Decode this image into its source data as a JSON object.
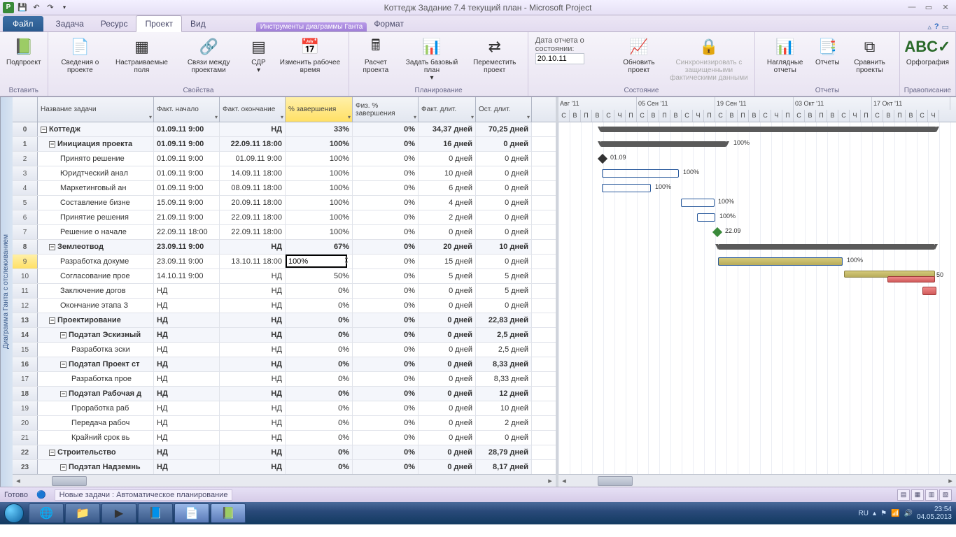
{
  "app_title": "Коттедж Задание 7.4 текущий план - Microsoft Project",
  "context_tab_header": "Инструменты диаграммы Ганта",
  "tabs": {
    "file": "Файл",
    "task": "Задача",
    "resource": "Ресурс",
    "project": "Проект",
    "view": "Вид",
    "format": "Формат"
  },
  "ribbon": {
    "insert_group": "Вставить",
    "subproject": "Подпроект",
    "props_group": "Свойства",
    "info": "Сведения о проекте",
    "custom": "Настраиваемые поля",
    "links": "Связи между проектами",
    "wbs": "СДР",
    "chtime": "Изменить рабочее время",
    "planning_group": "Планирование",
    "calc": "Расчет проекта",
    "baseline": "Задать базовый план",
    "move": "Переместить проект",
    "status_date_label": "Дата отчета о состоянии:",
    "status_date": "20.10.11",
    "state_group": "Состояние",
    "update": "Обновить проект",
    "sync": "Синхронизировать с защищенными фактическими данными",
    "reports_group": "Отчеты",
    "visrep": "Наглядные отчеты",
    "reports": "Отчеты",
    "compare": "Сравнить проекты",
    "spelling_group": "Правописание",
    "spelling": "Орфография"
  },
  "vertical_tab": "Диаграмма Ганта с отслеживанием",
  "columns": {
    "name": "Название задачи",
    "start": "Факт. начало",
    "end": "Факт. окончание",
    "pct": "% завершения",
    "phys": "Физ. % завершения",
    "dur": "Факт. длит.",
    "rem": "Ост. длит."
  },
  "timeline_months": [
    "Авг '11",
    "05 Сен '11",
    "19 Сен '11",
    "03 Окт '11",
    "17 Окт '11"
  ],
  "timeline_days": [
    "С",
    "В",
    "П",
    "В",
    "С",
    "Ч",
    "П",
    "С",
    "В",
    "П",
    "В",
    "С",
    "Ч",
    "П",
    "С",
    "В",
    "П",
    "В",
    "С",
    "Ч",
    "П",
    "С",
    "В",
    "П",
    "В",
    "С",
    "Ч",
    "П",
    "С",
    "В",
    "П",
    "В",
    "С",
    "Ч"
  ],
  "editor_value": "100%",
  "rows": [
    {
      "n": "0",
      "sum": true,
      "ind": 0,
      "name": "Коттедж",
      "start": "01.09.11 9:00",
      "end": "НД",
      "pct": "33%",
      "phys": "0%",
      "dur": "34,37 дней",
      "rem": "70,25 дней"
    },
    {
      "n": "1",
      "sum": true,
      "ind": 1,
      "name": "Инициация проекта",
      "start": "01.09.11 9:00",
      "end": "22.09.11 18:00",
      "pct": "100%",
      "phys": "0%",
      "dur": "16 дней",
      "rem": "0 дней"
    },
    {
      "n": "2",
      "ind": 2,
      "name": "Принято решение",
      "start": "01.09.11 9:00",
      "end": "01.09.11 9:00",
      "pct": "100%",
      "phys": "0%",
      "dur": "0 дней",
      "rem": "0 дней"
    },
    {
      "n": "3",
      "ind": 2,
      "name": "Юридтческий анал",
      "start": "01.09.11 9:00",
      "end": "14.09.11 18:00",
      "pct": "100%",
      "phys": "0%",
      "dur": "10 дней",
      "rem": "0 дней"
    },
    {
      "n": "4",
      "ind": 2,
      "name": "Маркетинговый ан",
      "start": "01.09.11 9:00",
      "end": "08.09.11 18:00",
      "pct": "100%",
      "phys": "0%",
      "dur": "6 дней",
      "rem": "0 дней"
    },
    {
      "n": "5",
      "ind": 2,
      "name": "Составление бизне",
      "start": "15.09.11 9:00",
      "end": "20.09.11 18:00",
      "pct": "100%",
      "phys": "0%",
      "dur": "4 дней",
      "rem": "0 дней"
    },
    {
      "n": "6",
      "ind": 2,
      "name": "Принятие решения",
      "start": "21.09.11 9:00",
      "end": "22.09.11 18:00",
      "pct": "100%",
      "phys": "0%",
      "dur": "2 дней",
      "rem": "0 дней"
    },
    {
      "n": "7",
      "ind": 2,
      "name": "Решение о начале",
      "start": "22.09.11 18:00",
      "end": "22.09.11 18:00",
      "pct": "100%",
      "phys": "0%",
      "dur": "0 дней",
      "rem": "0 дней"
    },
    {
      "n": "8",
      "sum": true,
      "ind": 1,
      "name": "Землеотвод",
      "start": "23.09.11 9:00",
      "end": "НД",
      "pct": "67%",
      "phys": "0%",
      "dur": "20 дней",
      "rem": "10 дней"
    },
    {
      "n": "9",
      "ind": 2,
      "name": "Разработка докуме",
      "start": "23.09.11 9:00",
      "end": "13.10.11 18:00",
      "pct": "",
      "phys": "0%",
      "dur": "15 дней",
      "rem": "0 дней",
      "editor": true
    },
    {
      "n": "10",
      "ind": 2,
      "name": "Согласование прое",
      "start": "14.10.11 9:00",
      "end": "НД",
      "pct": "50%",
      "phys": "0%",
      "dur": "5 дней",
      "rem": "5 дней"
    },
    {
      "n": "11",
      "ind": 2,
      "name": "Заключение догов",
      "start": "НД",
      "end": "НД",
      "pct": "0%",
      "phys": "0%",
      "dur": "0 дней",
      "rem": "5 дней"
    },
    {
      "n": "12",
      "ind": 2,
      "name": "Окончание этапа З",
      "start": "НД",
      "end": "НД",
      "pct": "0%",
      "phys": "0%",
      "dur": "0 дней",
      "rem": "0 дней"
    },
    {
      "n": "13",
      "sum": true,
      "ind": 1,
      "name": "Проектирование",
      "start": "НД",
      "end": "НД",
      "pct": "0%",
      "phys": "0%",
      "dur": "0 дней",
      "rem": "22,83 дней"
    },
    {
      "n": "14",
      "sum": true,
      "ind": 2,
      "name": "Подэтап Эскизный",
      "start": "НД",
      "end": "НД",
      "pct": "0%",
      "phys": "0%",
      "dur": "0 дней",
      "rem": "2,5 дней"
    },
    {
      "n": "15",
      "ind": 3,
      "name": "Разработка эски",
      "start": "НД",
      "end": "НД",
      "pct": "0%",
      "phys": "0%",
      "dur": "0 дней",
      "rem": "2,5 дней"
    },
    {
      "n": "16",
      "sum": true,
      "ind": 2,
      "name": "Подэтап Проект ст",
      "start": "НД",
      "end": "НД",
      "pct": "0%",
      "phys": "0%",
      "dur": "0 дней",
      "rem": "8,33 дней"
    },
    {
      "n": "17",
      "ind": 3,
      "name": "Разработка прое",
      "start": "НД",
      "end": "НД",
      "pct": "0%",
      "phys": "0%",
      "dur": "0 дней",
      "rem": "8,33 дней"
    },
    {
      "n": "18",
      "sum": true,
      "ind": 2,
      "name": "Подэтап Рабочая д",
      "start": "НД",
      "end": "НД",
      "pct": "0%",
      "phys": "0%",
      "dur": "0 дней",
      "rem": "12 дней"
    },
    {
      "n": "19",
      "ind": 3,
      "name": "Проработка раб",
      "start": "НД",
      "end": "НД",
      "pct": "0%",
      "phys": "0%",
      "dur": "0 дней",
      "rem": "10 дней"
    },
    {
      "n": "20",
      "ind": 3,
      "name": "Передача рабоч",
      "start": "НД",
      "end": "НД",
      "pct": "0%",
      "phys": "0%",
      "dur": "0 дней",
      "rem": "2 дней"
    },
    {
      "n": "21",
      "ind": 3,
      "name": "Крайний срок вь",
      "start": "НД",
      "end": "НД",
      "pct": "0%",
      "phys": "0%",
      "dur": "0 дней",
      "rem": "0 дней"
    },
    {
      "n": "22",
      "sum": true,
      "ind": 1,
      "name": "Строительство",
      "start": "НД",
      "end": "НД",
      "pct": "0%",
      "phys": "0%",
      "dur": "0 дней",
      "rem": "28,79 дней"
    },
    {
      "n": "23",
      "sum": true,
      "ind": 2,
      "name": "Подэтап Надземнь",
      "start": "НД",
      "end": "НД",
      "pct": "0%",
      "phys": "0%",
      "dur": "0 дней",
      "rem": "8,17 дней"
    }
  ],
  "gantt_labels": {
    "a": "100%",
    "b": "01.09",
    "c": "100%",
    "d": "100%",
    "e": "100%",
    "f": "100%",
    "g": "22.09",
    "h": "100%",
    "i": "50"
  },
  "status": {
    "ready": "Готово",
    "mode": "Новые задачи : Автоматическое планирование"
  },
  "tray": {
    "lang": "RU",
    "time": "23:54",
    "date": "04.05.2013"
  }
}
